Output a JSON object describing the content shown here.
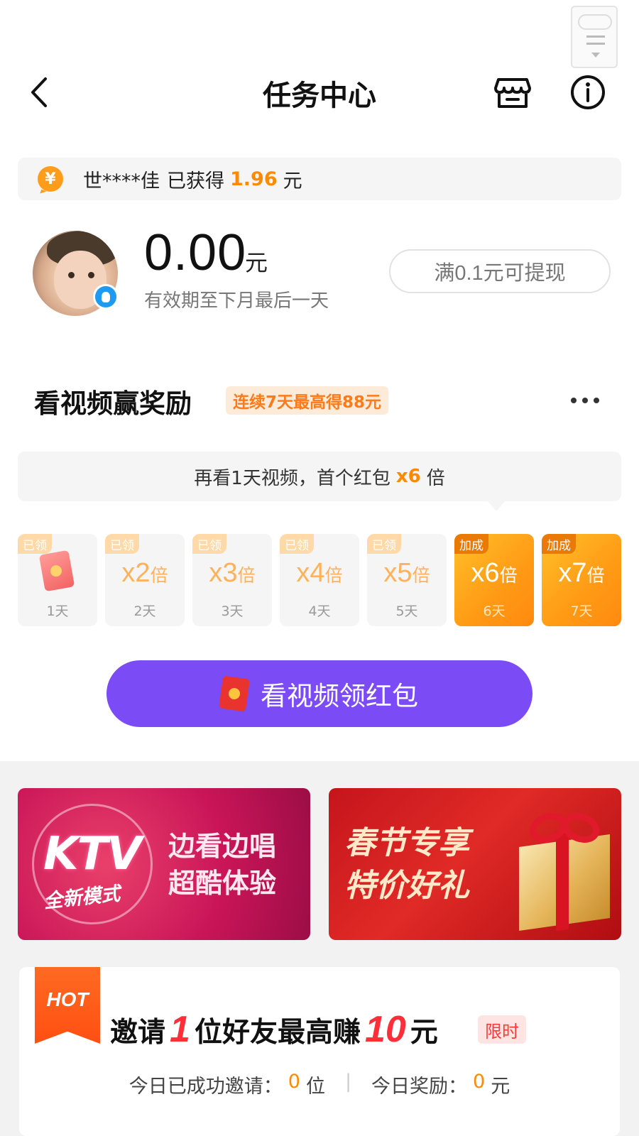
{
  "header": {
    "title": "任务中心"
  },
  "notice": {
    "user": "世****佳",
    "text": "已获得",
    "amount": "1.96",
    "unit": "元",
    "coin_symbol": "¥"
  },
  "account": {
    "balance": "0.00",
    "unit": "元",
    "validity": "有效期至下月最后一天",
    "withdraw_label": "满0.1元可提现"
  },
  "video_task": {
    "title": "看视频赢奖励",
    "tag": "连续7天最高得88元",
    "tip_prefix": "再看1天视频，首个红包",
    "tip_multiplier": "x6",
    "tip_suffix": "倍",
    "days": [
      {
        "badge": "已领",
        "multiplier": "",
        "unit": "",
        "day": "1天",
        "state": "claimed",
        "icon": "red-envelope-icon"
      },
      {
        "badge": "已领",
        "multiplier": "x2",
        "unit": "倍",
        "day": "2天",
        "state": "claimed"
      },
      {
        "badge": "已领",
        "multiplier": "x3",
        "unit": "倍",
        "day": "3天",
        "state": "claimed"
      },
      {
        "badge": "已领",
        "multiplier": "x4",
        "unit": "倍",
        "day": "4天",
        "state": "claimed"
      },
      {
        "badge": "已领",
        "multiplier": "x5",
        "unit": "倍",
        "day": "5天",
        "state": "claimed"
      },
      {
        "badge": "加成",
        "multiplier": "x6",
        "unit": "倍",
        "day": "6天",
        "state": "bonus"
      },
      {
        "badge": "加成",
        "multiplier": "x7",
        "unit": "倍",
        "day": "7天",
        "state": "bonus"
      }
    ],
    "button_label": "看视频领红包"
  },
  "banners": {
    "ktv": {
      "logo": "KTV",
      "sub": "全新模式",
      "line1": "边看边唱",
      "line2": "超酷体验"
    },
    "spring": {
      "line1": "春节专享",
      "line2": "特价好礼"
    }
  },
  "invite": {
    "hot_label": "HOT",
    "title_prefix": "邀请",
    "count": "1",
    "title_middle": "位好友最高赚",
    "reward": "10",
    "title_unit": "元",
    "limited_label": "限时",
    "invited_label": "今日已成功邀请：",
    "invited_count": "0",
    "invited_unit": "位",
    "separator": "|",
    "reward_label": "今日奖励：",
    "reward_today": "0",
    "reward_unit": "元"
  },
  "colors": {
    "accent_orange": "#ff8a00",
    "button_purple": "#7b4cf5",
    "hot_red": "#ff4f12",
    "highlight_red": "#ff2f3a"
  }
}
